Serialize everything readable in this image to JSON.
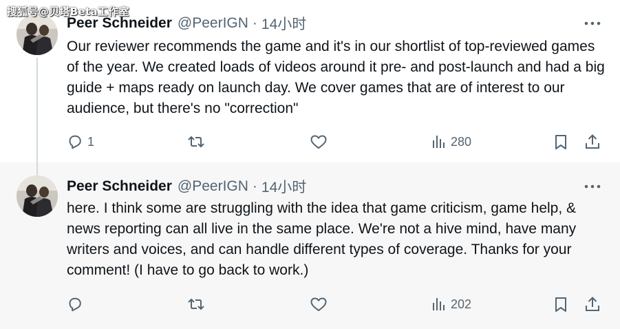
{
  "watermark": "搜狐号@贝塔Beta工作室",
  "colors": {
    "text_primary": "#0f1419",
    "text_secondary": "#536471",
    "thread_line": "#cfd9de",
    "highlight_bg": "#f7f7f7"
  },
  "tweets": [
    {
      "author": "Peer Schneider",
      "handle": "@PeerIGN",
      "separator": "·",
      "time": "14小时",
      "text": "Our reviewer recommends the game and it's in our shortlist of top-reviewed games of the year. We created loads of videos around it pre- and post-launch and had a big guide + maps ready on launch day. We cover games that are of interest to our audience, but there's no \"correction\"",
      "replies": "1",
      "views": "280",
      "icons": [
        "reply-icon",
        "repost-icon",
        "like-icon",
        "views-icon",
        "bookmark-icon",
        "share-icon",
        "more-icon"
      ]
    },
    {
      "author": "Peer Schneider",
      "handle": "@PeerIGN",
      "separator": "·",
      "time": "14小时",
      "text": "here. I think some are struggling with the idea that game criticism, game help, & news reporting can all live in the same place. We're not a hive mind, have many writers and voices, and can handle different types of coverage. Thanks for your comment! (I have to go back to work.)",
      "replies": "",
      "views": "202",
      "icons": [
        "reply-icon",
        "repost-icon",
        "like-icon",
        "views-icon",
        "bookmark-icon",
        "share-icon",
        "more-icon"
      ]
    }
  ]
}
